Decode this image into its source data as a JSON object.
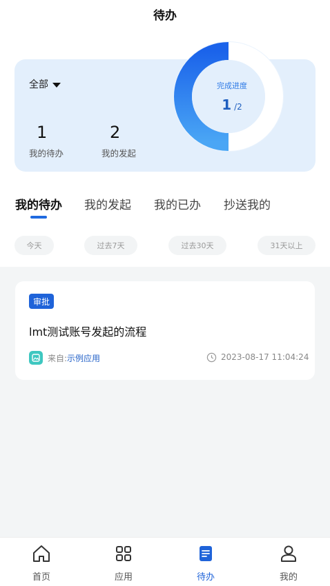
{
  "header": {
    "title": "待办"
  },
  "summary": {
    "filter_label": "全部",
    "todo_count": "1",
    "todo_label": "我的待办",
    "started_count": "2",
    "started_label": "我的发起",
    "progress_label": "完成进度",
    "progress_done": "1",
    "progress_total": "/2",
    "progress_fraction": 0.5
  },
  "tabs": [
    {
      "label": "我的待办",
      "active": true
    },
    {
      "label": "我的发起",
      "active": false
    },
    {
      "label": "我的已办",
      "active": false
    },
    {
      "label": "抄送我的",
      "active": false
    }
  ],
  "chips": [
    "今天",
    "过去7天",
    "过去30天",
    "31天以上"
  ],
  "tasks": [
    {
      "badge": "审批",
      "title": "lmt测试账号发起的流程",
      "source_prefix": "来自:",
      "source_app": "示例应用",
      "time": "2023-08-17 11:04:24"
    }
  ],
  "nav": [
    {
      "label": "首页",
      "icon": "home-icon",
      "active": false
    },
    {
      "label": "应用",
      "icon": "grid-icon",
      "active": false
    },
    {
      "label": "待办",
      "icon": "todo-doc-icon",
      "active": true
    },
    {
      "label": "我的",
      "icon": "user-icon",
      "active": false
    }
  ],
  "colors": {
    "accent": "#1f63d9",
    "card_bg": "#e3effc",
    "content_bg": "#f3f5f6"
  }
}
